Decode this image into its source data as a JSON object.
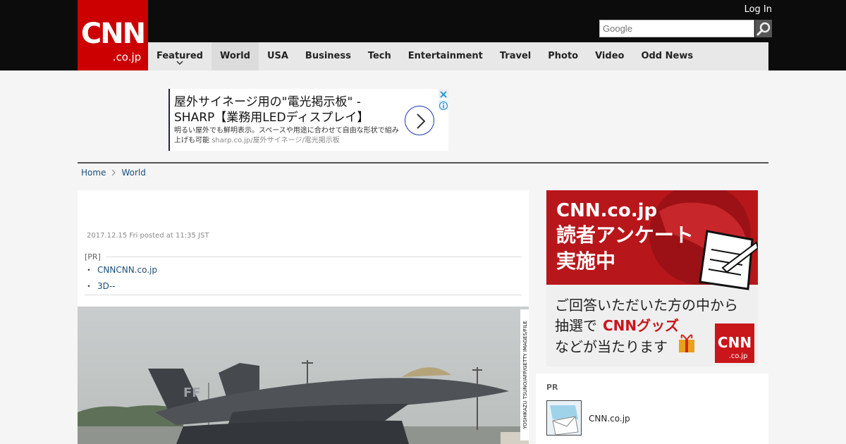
{
  "header": {
    "logo_main": "CNN",
    "logo_sub": ".co.jp",
    "login": "Log In",
    "search_placeholder": "Google"
  },
  "nav": {
    "items": [
      "Featured",
      "World",
      "USA",
      "Business",
      "Tech",
      "Entertainment",
      "Travel",
      "Photo",
      "Video",
      "Odd News"
    ],
    "active": "World"
  },
  "ad": {
    "headline": "屋外サイネージ用の\"電光掲示板\" - SHARP【業務用LEDディスプレイ】",
    "desc": "明るい屋外でも鮮明表示。スペースや用途に合わせて自由な形状で組み上げも可能",
    "url": "sharp.co.jp/屋外サイネージ/電光掲示板"
  },
  "breadcrumb": {
    "home": "Home",
    "current": "World"
  },
  "article": {
    "date": "2017.12.15 Fri posted at 11:35 JST",
    "pr_label": "[PR]",
    "pr_links": [
      "CNNCNN.co.jp",
      "3D--"
    ],
    "photo_credit": "YOSHIKAZU TSUNO/AFP/GETTY IMAGES/FILE",
    "jet_tail_mark": "FF"
  },
  "sidebar": {
    "banner_line1": "CNN.co.jp",
    "banner_line2": "読者アンケート",
    "banner_line3": "実施中",
    "banner_sub1": "ご回答いただいた方の中から",
    "banner_sub2a": "抽選で",
    "banner_sub2b": "CNNグッズ",
    "banner_sub3": "などが当たります",
    "banner_logo_main": "CNN",
    "banner_logo_sub": ".co.jp",
    "pr_title": "PR",
    "pr_item_label": "CNN.co.jp"
  }
}
